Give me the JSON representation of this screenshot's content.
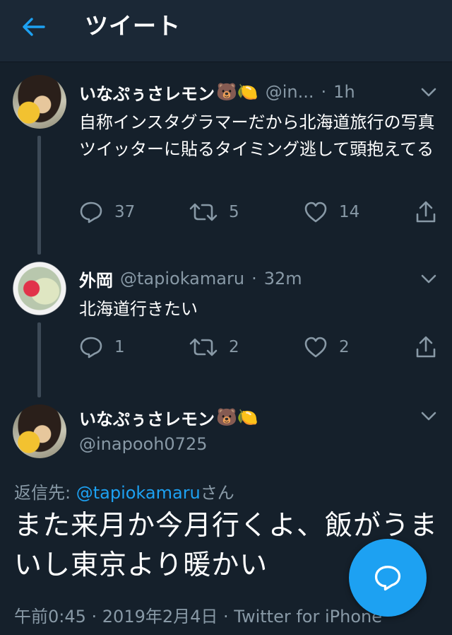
{
  "header": {
    "title": "ツイート"
  },
  "tweets": [
    {
      "display_name": "いなぷぅさレモン",
      "emoji": "🐻🍋",
      "handle": "@in...",
      "time": "1h",
      "text": "自称インスタグラマーだから北海道旅行の写真ツイッターに貼るタイミング逃して頭抱えてる",
      "replies": "37",
      "retweets": "5",
      "likes": "14"
    },
    {
      "display_name": "外岡",
      "handle": "@tapiokamaru",
      "time": "32m",
      "text": "北海道行きたい",
      "replies": "1",
      "retweets": "2",
      "likes": "2"
    }
  ],
  "focused": {
    "display_name": "いなぷぅさレモン",
    "emoji": "🐻🍋",
    "handle": "@inapooh0725",
    "reply_prefix": "返信先: ",
    "reply_to": "@tapiokamaru",
    "reply_suffix": "さん",
    "text": "また来月か今月行くよ、飯がうまいし東京より暖かい",
    "timestamp": "午前0:45 · 2019年2月4日 · Twitter for iPhone"
  },
  "colors": {
    "background": "#15202b",
    "header": "#1b2836",
    "accent": "#1da1f2",
    "secondary": "#8899a6"
  },
  "icons": [
    "back-arrow-icon",
    "chevron-down-icon",
    "reply-icon",
    "retweet-icon",
    "like-icon",
    "share-icon",
    "compose-reply-icon"
  ]
}
